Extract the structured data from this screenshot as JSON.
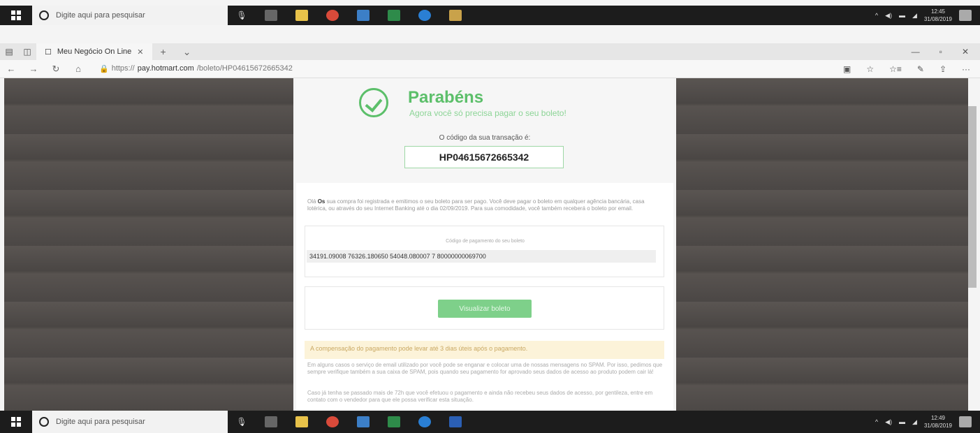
{
  "taskbar": {
    "search_placeholder": "Digite aqui para pesquisar",
    "top_clock_time": "12:45",
    "top_clock_date": "31/08/2019",
    "bottom_clock_time": "12:49",
    "bottom_clock_date": "31/08/2019"
  },
  "browser": {
    "tab_title": "Meu Negócio On Line",
    "url_prefix": "https://",
    "url_domain": "pay.hotmart.com",
    "url_rest": "/boleto/HP04615672665342"
  },
  "page": {
    "title": "Parabéns",
    "subtitle": "Agora você só precisa pagar o seu boleto!",
    "code_label": "O código da sua transação é:",
    "transaction_code": "HP04615672665342",
    "para1_name": "Os",
    "para1_text_a": "Olá",
    "para1_text_b": "sua compra foi registrada e emitimos o seu boleto para ser pago. Você deve pagar o boleto em qualquer agência bancária, casa lotérica, ou através do seu Internet Banking até o dia 02/09/2019. Para sua comodidade, você também receberá o boleto por email.",
    "barcode_label": "Código de pagamento do seu boleto",
    "barcode": "34191.09008 76326.180650 54048.080007 7 80000000069700",
    "view_button": "Visualizar boleto",
    "alert": "A compensação do pagamento pode levar até 3 dias úteis após o pagamento.",
    "para2": "Em alguns casos o serviço de email utilizado por você pode se enganar e colocar uma de nossas mensagens no SPAM. Por isso, pedimos que sempre verifique também a sua caixa de SPAM, pois quando seu pagamento for aprovado seus dados de acesso ao produto podem cair lá!",
    "para3": "Caso já tenha se passado mais de 72h que você efetuou o pagamento e ainda não recebeu seus dados de acesso, por gentileza, entre em contato com o vendedor para que ele possa verificar esta situação."
  },
  "colors": {
    "accent": "#5cbf6a",
    "button": "#7ed08a",
    "alert_bg": "#fcf3d9"
  }
}
